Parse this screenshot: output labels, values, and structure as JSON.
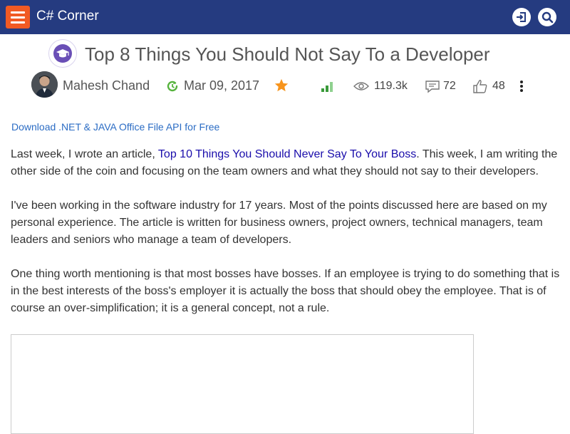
{
  "header": {
    "brand": "C# Corner",
    "colors": {
      "bar": "#253b80",
      "menu_button": "#f15a24"
    },
    "icons": {
      "menu": "hamburger-icon",
      "login": "login-icon",
      "search": "search-icon"
    }
  },
  "article": {
    "category_icon": "graduation-cap-icon",
    "title": "Top 8 Things You Should Not Say To a Developer",
    "author": "Mahesh Chand",
    "date": "Mar 09, 2017",
    "featured_icon": "star-icon",
    "level_icon": "signal-bars-icon",
    "views": "119.3k",
    "comments": "72",
    "likes": "48",
    "more_icon": "vertical-dots-icon"
  },
  "promo": {
    "link_text": "Download .NET & JAVA Office File API for Free"
  },
  "body": {
    "p1_before": "Last week, I wrote an article, ",
    "p1_link": "Top 10 Things You Should Never Say To Your Boss",
    "p1_after": ". This week, I am writing the other side of the coin and focusing on the team owners and what they should not say to their developers.",
    "p2": "I've been working in the software industry for 17 years. Most of the points discussed here are based on my personal experience. The article is written for business owners, project owners, technical managers, team leaders and seniors who manage a team of developers.",
    "p3": "One thing worth mentioning is that most bosses have bosses. If an employee is trying to do something that is in the best interests of the boss's employer it is actually the boss that should obey the employee. That is of course an over-simplification; it is a general concept, not a rule."
  }
}
